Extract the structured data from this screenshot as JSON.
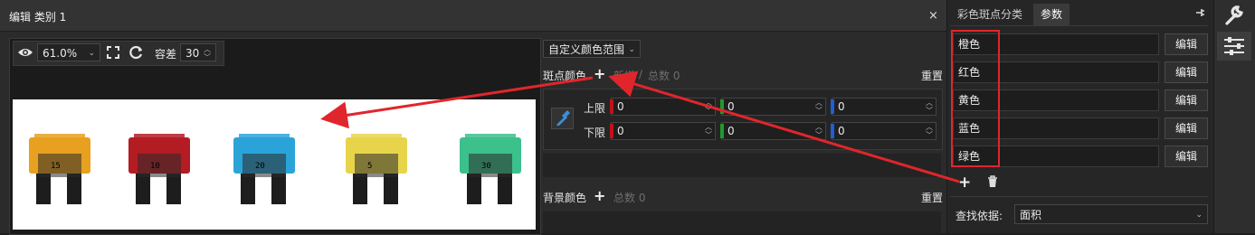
{
  "dialog": {
    "title": "编辑 类别 1",
    "close_glyph": "×"
  },
  "toolbar": {
    "zoom_value": "61.0%",
    "tolerance_label": "容差",
    "tolerance_value": "30"
  },
  "color_mode": {
    "selected": "自定义颜色范围"
  },
  "spot_color": {
    "label": "斑点颜色",
    "add_glyph": "+",
    "new_label": "新增",
    "separator": "/",
    "total_label": "总数 0",
    "reset_label": "重置",
    "upper_label": "上限",
    "lower_label": "下限",
    "channels": {
      "upper": [
        "0",
        "0",
        "0"
      ],
      "lower": [
        "0",
        "0",
        "0"
      ]
    },
    "channel_colors": [
      "#c1121a",
      "#1f9a2b",
      "#1f5fd6"
    ]
  },
  "background_color": {
    "label": "背景颜色",
    "add_glyph": "+",
    "total_label": "总数 0",
    "reset_label": "重置"
  },
  "right_panel": {
    "tabs": [
      "彩色斑点分类",
      "参数"
    ],
    "active_tab": 1,
    "pin_glyph": "📌",
    "classes": [
      {
        "name": "橙色",
        "edit_label": "编辑"
      },
      {
        "name": "红色",
        "edit_label": "编辑"
      },
      {
        "name": "黄色",
        "edit_label": "编辑"
      },
      {
        "name": "蓝色",
        "edit_label": "编辑"
      },
      {
        "name": "绿色",
        "edit_label": "编辑"
      }
    ],
    "add_glyph": "+",
    "find_by_label": "查找依据:",
    "find_by_value": "面积"
  },
  "side_strip": {
    "icons": [
      "wrench-icon",
      "sliders-icon"
    ]
  },
  "annotation": {
    "color": "#e0262c",
    "box_color": "#e0262c"
  },
  "fuses": [
    {
      "color": "#e8a020",
      "mark": "15"
    },
    {
      "color": "#b41c24",
      "mark": "10"
    },
    {
      "color": "#2aa4d8",
      "mark": "20"
    },
    {
      "color": "#e7d44a",
      "mark": "5"
    },
    {
      "color": "#3cc08c",
      "mark": "30"
    }
  ]
}
